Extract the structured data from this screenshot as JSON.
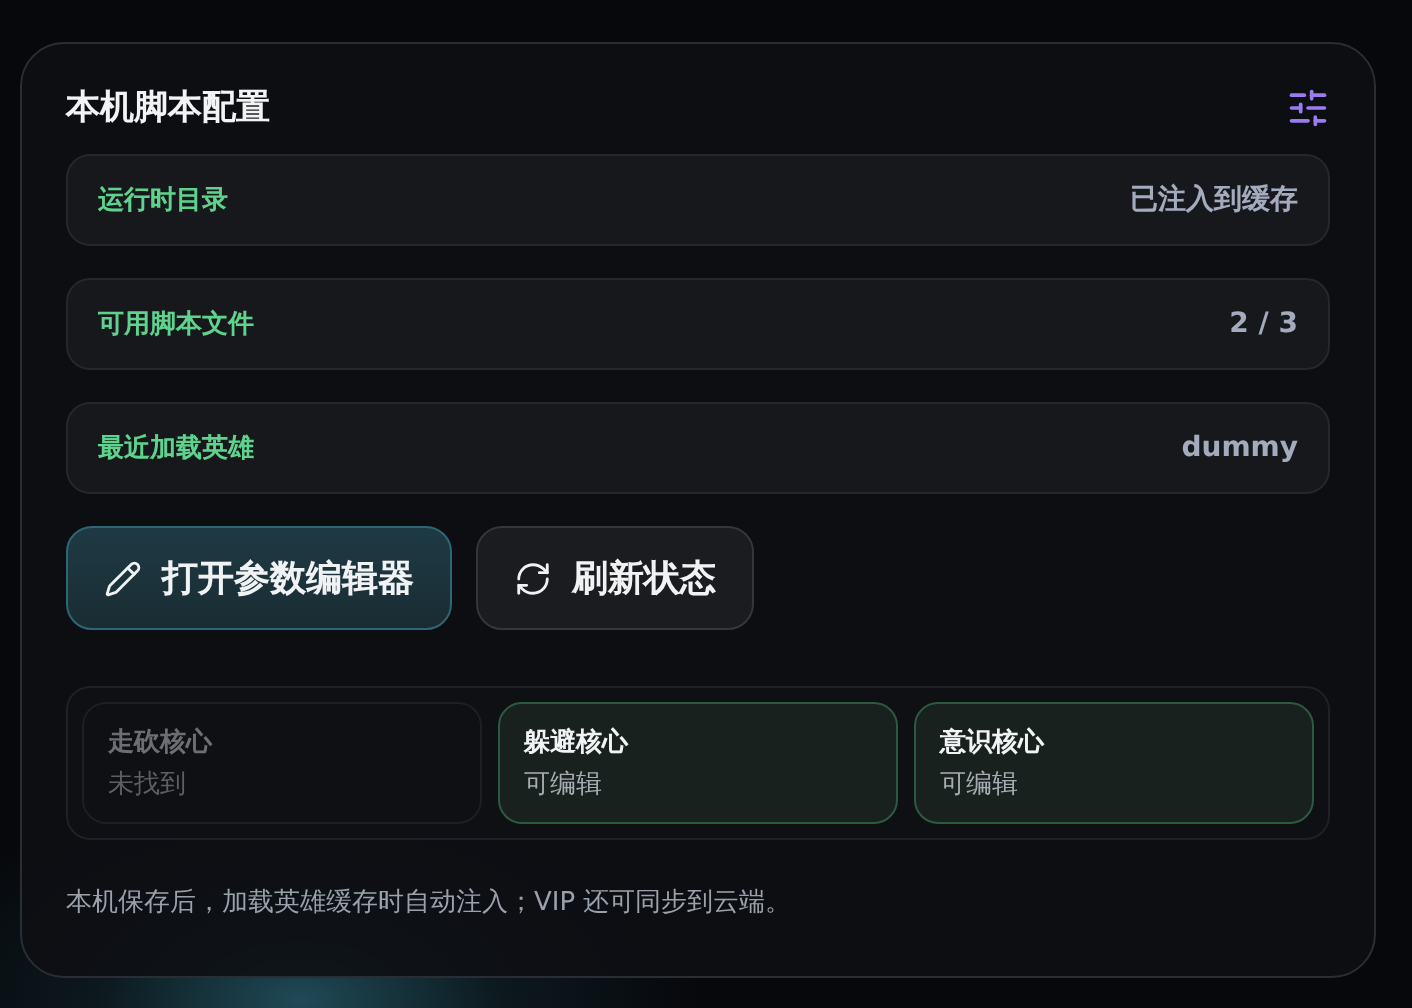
{
  "panel": {
    "title": "本机脚本配置"
  },
  "info_rows": [
    {
      "label": "运行时目录",
      "value": "已注入到缓存"
    },
    {
      "label": "可用脚本文件",
      "value": "2 / 3"
    },
    {
      "label": "最近加载英雄",
      "value": "dummy"
    }
  ],
  "buttons": [
    {
      "label": "打开参数编辑器",
      "kind": "primary"
    },
    {
      "label": "刷新状态",
      "kind": "secondary"
    }
  ],
  "cores": [
    {
      "name": "走砍核心",
      "status": "未找到",
      "available": false
    },
    {
      "name": "躲避核心",
      "status": "可编辑",
      "available": true
    },
    {
      "name": "意识核心",
      "status": "可编辑",
      "available": true
    }
  ],
  "footnote": "本机保存后，加载英雄缓存时自动注入；VIP 还可同步到云端。"
}
